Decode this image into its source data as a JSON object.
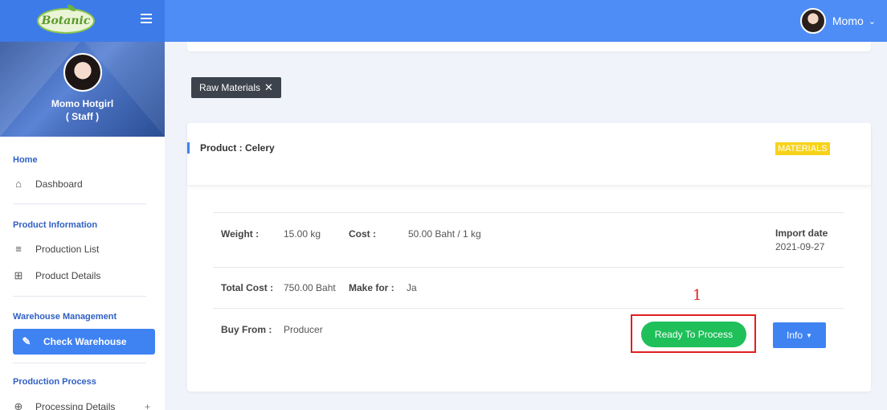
{
  "app": {
    "logo_text": "Botanic"
  },
  "topbar": {
    "user_name": "Momo"
  },
  "profile": {
    "name": "Momo Hotgirl",
    "role": "( Staff )"
  },
  "sidebar": {
    "sections": [
      {
        "title": "Home",
        "items": [
          {
            "label": "Dashboard",
            "icon": "home-icon"
          }
        ]
      },
      {
        "title": "Product Information",
        "items": [
          {
            "label": "Production List",
            "icon": "list-icon"
          },
          {
            "label": "Product Details",
            "icon": "grid-icon"
          }
        ]
      },
      {
        "title": "Warehouse Management",
        "items": [
          {
            "label": "Check Warehouse",
            "icon": "edit-icon",
            "active": true
          }
        ]
      },
      {
        "title": "Production Process",
        "items": [
          {
            "label": "Processing Details",
            "icon": "globe-icon",
            "suffix": "+"
          }
        ]
      }
    ]
  },
  "filter": {
    "label": "Raw Materials",
    "close": "✕"
  },
  "product": {
    "title": "Product : Celery",
    "badge": "MATERIALS",
    "weight_label": "Weight :",
    "weight_value": "15.00 kg",
    "cost_label": "Cost :",
    "cost_value": "50.00 Baht / 1 kg",
    "import_label": "Import date",
    "import_value": "2021-09-27",
    "total_label": "Total Cost :",
    "total_value": "750.00 Baht",
    "makefor_label": "Make for :",
    "makefor_value": "Ja",
    "buyfrom_label": "Buy From :",
    "buyfrom_value": "Producer"
  },
  "actions": {
    "ready_label": "Ready To Process",
    "info_label": "Info"
  },
  "annotation": {
    "number": "1"
  },
  "colors": {
    "primary": "#3f83f3",
    "success": "#1fbf5a",
    "badge": "#f7d21a",
    "annotation": "#e02020"
  }
}
